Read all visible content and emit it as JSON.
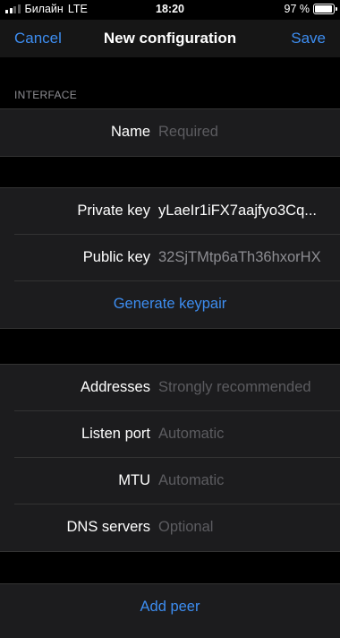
{
  "status_bar": {
    "carrier": "Билайн",
    "network": "LTE",
    "time": "18:20",
    "battery_percent_label": "97 %",
    "battery_level": 0.97,
    "signal_bars_active": 2,
    "signal_bars_total": 4
  },
  "nav": {
    "cancel_label": "Cancel",
    "title": "New configuration",
    "save_label": "Save"
  },
  "section": {
    "header": "INTERFACE"
  },
  "fields": {
    "name": {
      "label": "Name",
      "placeholder": "Required"
    },
    "private_key": {
      "label": "Private key",
      "value": "yLaeIr1iFX7aajfyo3Cq..."
    },
    "public_key": {
      "label": "Public key",
      "value": "32SjTMtp6aTh36hxorHX"
    },
    "generate_keypair_label": "Generate keypair",
    "addresses": {
      "label": "Addresses",
      "placeholder": "Strongly recommended"
    },
    "listen_port": {
      "label": "Listen port",
      "placeholder": "Automatic"
    },
    "mtu": {
      "label": "MTU",
      "placeholder": "Automatic"
    },
    "dns_servers": {
      "label": "DNS servers",
      "placeholder": "Optional"
    }
  },
  "bottom_action_label": "Add peer",
  "colors": {
    "accent": "#3d8df0",
    "background": "#000000",
    "cell": "#1c1c1e",
    "placeholder": "#5c5c60"
  }
}
